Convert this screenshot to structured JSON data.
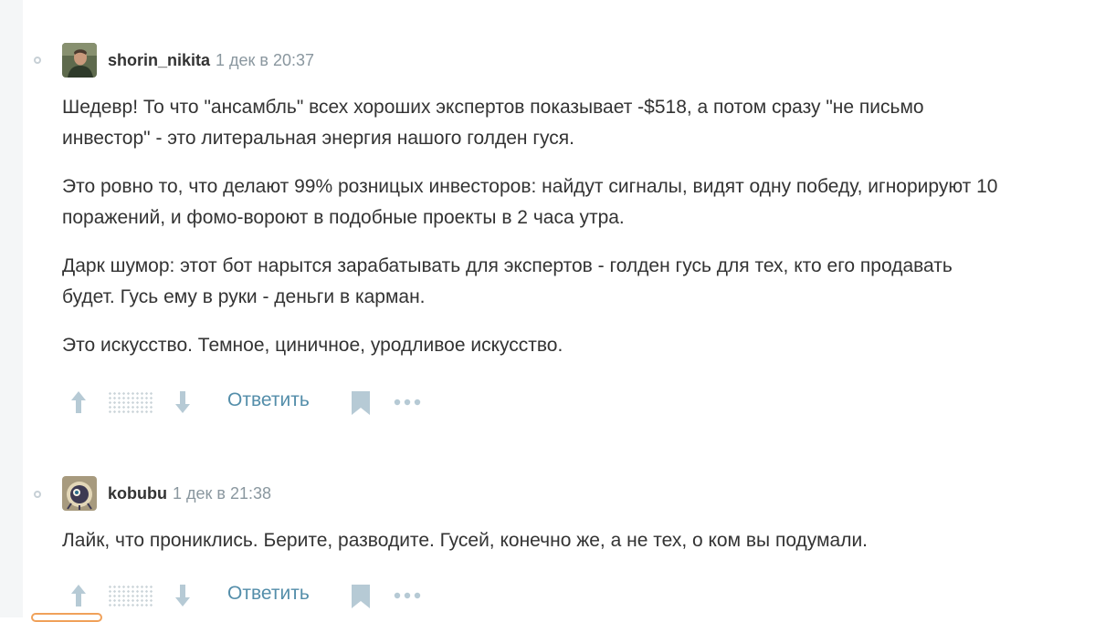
{
  "comments": [
    {
      "username": "shorin_nikita",
      "time": "1 дек в 20:37",
      "paragraphs": [
        "Шедевр! То что \"ансамбль\" всех хороших экспертов показывает -$518, а потом сразу \"не письмо",
        "инвестор\" - это литеральная энергия нашого голден гуся.",
        "Это ровно то, что делают 99% розницых инвесторов: найдут сигналы, видят одну победу, игнорируют 10",
        "поражений, и фомо-вороют в подобные проекты в 2 часа утра.",
        "Дарк шумор: этот бот нарытся зарабатывать для экспертов - голден гусь для тех, кто его продавать",
        "будет. Гусь ему в руки - деньги в карман.",
        "Это искусство. Темное, циничное, уродливое искусство."
      ],
      "reply_label": "Ответить"
    },
    {
      "username": "kobubu",
      "time": "1 дек в 21:38",
      "paragraphs": [
        "Лайк, что прониклись. Берите, разводите. Гусей, конечно же, а не тех, о ком вы подумали."
      ],
      "reply_label": "Ответить"
    }
  ],
  "colors": {
    "accent": "#548eaa",
    "icon": "#b6cad5",
    "muted": "#8a979f",
    "text": "#333333"
  }
}
